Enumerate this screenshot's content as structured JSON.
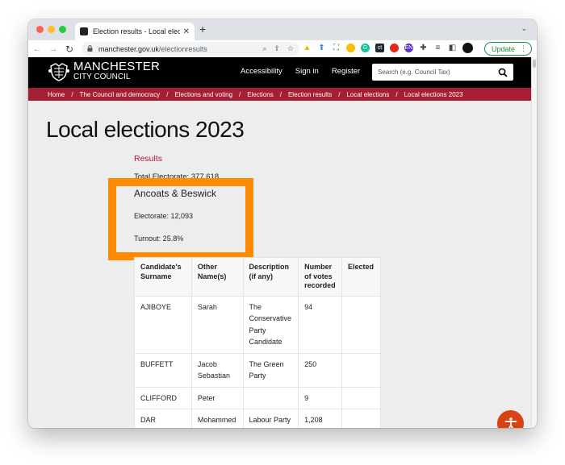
{
  "browser": {
    "tab": {
      "title": "Election results - Local election",
      "close_glyph": "✕",
      "favicon": "council-favicon"
    },
    "new_tab_glyph": "+",
    "tab_list_glyph": "⌄",
    "nav": {
      "back": "←",
      "forward": "→",
      "reload": "↻"
    },
    "omnibox": {
      "lock_glyph": "🔒",
      "host": "manchester.gov.uk",
      "path": "/electionresults",
      "zoom_glyph": "⌕",
      "share_glyph": "⇪",
      "bookmark_glyph": "☆"
    },
    "extensions": [
      {
        "name": "google-drive-extension",
        "glyph": "▲",
        "color": "#f4b400"
      },
      {
        "name": "extension-blue-arrow",
        "glyph": "⬆",
        "color": "#4285f4"
      },
      {
        "name": "screenshot-extension",
        "glyph": "⛶",
        "color": "#1e8e3e"
      },
      {
        "name": "keep-extension",
        "glyph": "●",
        "color": "#fbbc04"
      },
      {
        "name": "grammarly-extension",
        "glyph": "G",
        "color": "#15c39a"
      },
      {
        "name": "ct-extension",
        "glyph": "ct",
        "color": "#1f2a36"
      },
      {
        "name": "record-extension",
        "glyph": "●",
        "color": "#e8271c"
      },
      {
        "name": "en-extension",
        "glyph": "EN",
        "color": "#5b2fc9"
      },
      {
        "name": "extensions-puzzle",
        "glyph": "✚",
        "color": "#444444"
      },
      {
        "name": "reading-list",
        "glyph": "≡",
        "color": "#444444"
      },
      {
        "name": "side-panel",
        "glyph": "◧",
        "color": "#444444"
      },
      {
        "name": "profile-avatar",
        "glyph": "●",
        "color": "#111111"
      }
    ],
    "update_label": "Update",
    "menu_glyph": "⋮"
  },
  "site": {
    "logo": {
      "line1": "MANCHESTER",
      "line2": "CITY COUNCIL"
    },
    "nav": [
      "Accessibility",
      "Sign in",
      "Register"
    ],
    "search": {
      "placeholder": "Search (e.g. Council Tax)"
    },
    "breadcrumb": [
      "Home",
      "The Council and democracy",
      "Elections and voting",
      "Elections",
      "Election results",
      "Local elections",
      "Local elections 2023"
    ],
    "breadcrumb_separator": "/"
  },
  "main": {
    "title": "Local elections 2023",
    "results_link": "Results",
    "total_electorate": "Total Electorate: 377,618",
    "ward": {
      "name": "Ancoats & Beswick",
      "electorate": "Electorate: 12,093",
      "turnout": "Turnout: 25.8%"
    },
    "highlight_color": "#ff8c00",
    "table": {
      "headers": [
        "Candidate's Surname",
        "Other Name(s)",
        "Description (if any)",
        "Number of votes recorded",
        "Elected"
      ],
      "rows": [
        [
          "AJIBOYE",
          "Sarah",
          "The Conservative Party Candidate",
          "94",
          ""
        ],
        [
          "BUFFETT",
          "Jacob Sebastian",
          "The Green Party",
          "250",
          ""
        ],
        [
          "CLIFFORD",
          "Peter",
          "",
          "9",
          ""
        ],
        [
          "DAR",
          "Mohammed Majid",
          "Labour Party",
          "1,208",
          ""
        ]
      ]
    }
  },
  "accessibility_button": {
    "label": "Accessibility tools",
    "color": "#d84315"
  }
}
